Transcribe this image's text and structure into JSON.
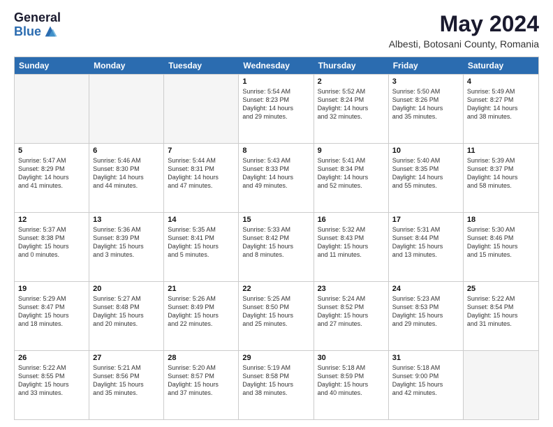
{
  "header": {
    "logo_general": "General",
    "logo_blue": "Blue",
    "title": "May 2024",
    "location": "Albesti, Botosani County, Romania"
  },
  "weekdays": [
    "Sunday",
    "Monday",
    "Tuesday",
    "Wednesday",
    "Thursday",
    "Friday",
    "Saturday"
  ],
  "rows": [
    [
      {
        "day": "",
        "text": "",
        "empty": true
      },
      {
        "day": "",
        "text": "",
        "empty": true
      },
      {
        "day": "",
        "text": "",
        "empty": true
      },
      {
        "day": "1",
        "text": "Sunrise: 5:54 AM\nSunset: 8:23 PM\nDaylight: 14 hours\nand 29 minutes.",
        "empty": false
      },
      {
        "day": "2",
        "text": "Sunrise: 5:52 AM\nSunset: 8:24 PM\nDaylight: 14 hours\nand 32 minutes.",
        "empty": false
      },
      {
        "day": "3",
        "text": "Sunrise: 5:50 AM\nSunset: 8:26 PM\nDaylight: 14 hours\nand 35 minutes.",
        "empty": false
      },
      {
        "day": "4",
        "text": "Sunrise: 5:49 AM\nSunset: 8:27 PM\nDaylight: 14 hours\nand 38 minutes.",
        "empty": false
      }
    ],
    [
      {
        "day": "5",
        "text": "Sunrise: 5:47 AM\nSunset: 8:29 PM\nDaylight: 14 hours\nand 41 minutes.",
        "empty": false
      },
      {
        "day": "6",
        "text": "Sunrise: 5:46 AM\nSunset: 8:30 PM\nDaylight: 14 hours\nand 44 minutes.",
        "empty": false
      },
      {
        "day": "7",
        "text": "Sunrise: 5:44 AM\nSunset: 8:31 PM\nDaylight: 14 hours\nand 47 minutes.",
        "empty": false
      },
      {
        "day": "8",
        "text": "Sunrise: 5:43 AM\nSunset: 8:33 PM\nDaylight: 14 hours\nand 49 minutes.",
        "empty": false
      },
      {
        "day": "9",
        "text": "Sunrise: 5:41 AM\nSunset: 8:34 PM\nDaylight: 14 hours\nand 52 minutes.",
        "empty": false
      },
      {
        "day": "10",
        "text": "Sunrise: 5:40 AM\nSunset: 8:35 PM\nDaylight: 14 hours\nand 55 minutes.",
        "empty": false
      },
      {
        "day": "11",
        "text": "Sunrise: 5:39 AM\nSunset: 8:37 PM\nDaylight: 14 hours\nand 58 minutes.",
        "empty": false
      }
    ],
    [
      {
        "day": "12",
        "text": "Sunrise: 5:37 AM\nSunset: 8:38 PM\nDaylight: 15 hours\nand 0 minutes.",
        "empty": false
      },
      {
        "day": "13",
        "text": "Sunrise: 5:36 AM\nSunset: 8:39 PM\nDaylight: 15 hours\nand 3 minutes.",
        "empty": false
      },
      {
        "day": "14",
        "text": "Sunrise: 5:35 AM\nSunset: 8:41 PM\nDaylight: 15 hours\nand 5 minutes.",
        "empty": false
      },
      {
        "day": "15",
        "text": "Sunrise: 5:33 AM\nSunset: 8:42 PM\nDaylight: 15 hours\nand 8 minutes.",
        "empty": false
      },
      {
        "day": "16",
        "text": "Sunrise: 5:32 AM\nSunset: 8:43 PM\nDaylight: 15 hours\nand 11 minutes.",
        "empty": false
      },
      {
        "day": "17",
        "text": "Sunrise: 5:31 AM\nSunset: 8:44 PM\nDaylight: 15 hours\nand 13 minutes.",
        "empty": false
      },
      {
        "day": "18",
        "text": "Sunrise: 5:30 AM\nSunset: 8:46 PM\nDaylight: 15 hours\nand 15 minutes.",
        "empty": false
      }
    ],
    [
      {
        "day": "19",
        "text": "Sunrise: 5:29 AM\nSunset: 8:47 PM\nDaylight: 15 hours\nand 18 minutes.",
        "empty": false
      },
      {
        "day": "20",
        "text": "Sunrise: 5:27 AM\nSunset: 8:48 PM\nDaylight: 15 hours\nand 20 minutes.",
        "empty": false
      },
      {
        "day": "21",
        "text": "Sunrise: 5:26 AM\nSunset: 8:49 PM\nDaylight: 15 hours\nand 22 minutes.",
        "empty": false
      },
      {
        "day": "22",
        "text": "Sunrise: 5:25 AM\nSunset: 8:50 PM\nDaylight: 15 hours\nand 25 minutes.",
        "empty": false
      },
      {
        "day": "23",
        "text": "Sunrise: 5:24 AM\nSunset: 8:52 PM\nDaylight: 15 hours\nand 27 minutes.",
        "empty": false
      },
      {
        "day": "24",
        "text": "Sunrise: 5:23 AM\nSunset: 8:53 PM\nDaylight: 15 hours\nand 29 minutes.",
        "empty": false
      },
      {
        "day": "25",
        "text": "Sunrise: 5:22 AM\nSunset: 8:54 PM\nDaylight: 15 hours\nand 31 minutes.",
        "empty": false
      }
    ],
    [
      {
        "day": "26",
        "text": "Sunrise: 5:22 AM\nSunset: 8:55 PM\nDaylight: 15 hours\nand 33 minutes.",
        "empty": false
      },
      {
        "day": "27",
        "text": "Sunrise: 5:21 AM\nSunset: 8:56 PM\nDaylight: 15 hours\nand 35 minutes.",
        "empty": false
      },
      {
        "day": "28",
        "text": "Sunrise: 5:20 AM\nSunset: 8:57 PM\nDaylight: 15 hours\nand 37 minutes.",
        "empty": false
      },
      {
        "day": "29",
        "text": "Sunrise: 5:19 AM\nSunset: 8:58 PM\nDaylight: 15 hours\nand 38 minutes.",
        "empty": false
      },
      {
        "day": "30",
        "text": "Sunrise: 5:18 AM\nSunset: 8:59 PM\nDaylight: 15 hours\nand 40 minutes.",
        "empty": false
      },
      {
        "day": "31",
        "text": "Sunrise: 5:18 AM\nSunset: 9:00 PM\nDaylight: 15 hours\nand 42 minutes.",
        "empty": false
      },
      {
        "day": "",
        "text": "",
        "empty": true
      }
    ]
  ]
}
